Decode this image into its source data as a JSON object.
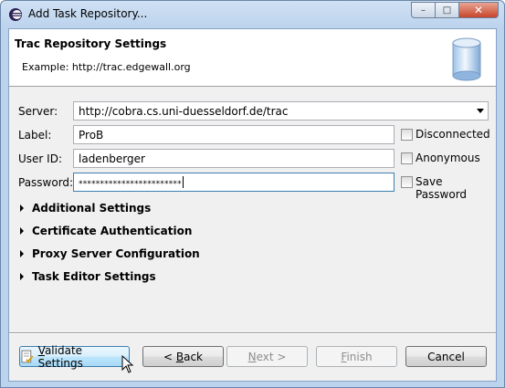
{
  "window": {
    "title": "Add Task Repository..."
  },
  "caption_buttons": {
    "minimize": "–",
    "maximize": "□",
    "close": "✕"
  },
  "header": {
    "title": "Trac Repository Settings",
    "description": "Example: http://trac.edgewall.org"
  },
  "form": {
    "server": {
      "label": "Server:",
      "value": "http://cobra.cs.uni-duesseldorf.de/trac"
    },
    "label_field": {
      "label": "Label:",
      "value": "ProB"
    },
    "user_id": {
      "label": "User ID:",
      "value": "ladenberger"
    },
    "password": {
      "label": "Password:",
      "value": "************************"
    },
    "checkboxes": {
      "disconnected": {
        "label": "Disconnected",
        "checked": false
      },
      "anonymous": {
        "label": "Anonymous",
        "checked": false
      },
      "save_password": {
        "label": "Save Password",
        "checked": false
      }
    }
  },
  "sections": [
    {
      "label": "Additional Settings"
    },
    {
      "label": "Certificate Authentication"
    },
    {
      "label": "Proxy Server Configuration"
    },
    {
      "label": "Task Editor Settings"
    }
  ],
  "buttons": {
    "validate": {
      "mnemonic": "V",
      "rest": "alidate Settings"
    },
    "back": {
      "prefix": "< ",
      "mnemonic": "B",
      "rest": "ack"
    },
    "next": {
      "mnemonic": "N",
      "rest": "ext >"
    },
    "finish": {
      "mnemonic": "F",
      "rest": "inish"
    },
    "cancel": {
      "label": "Cancel"
    }
  },
  "colors": {
    "accent": "#3c7fb1",
    "frame": "#bcd3ee"
  }
}
